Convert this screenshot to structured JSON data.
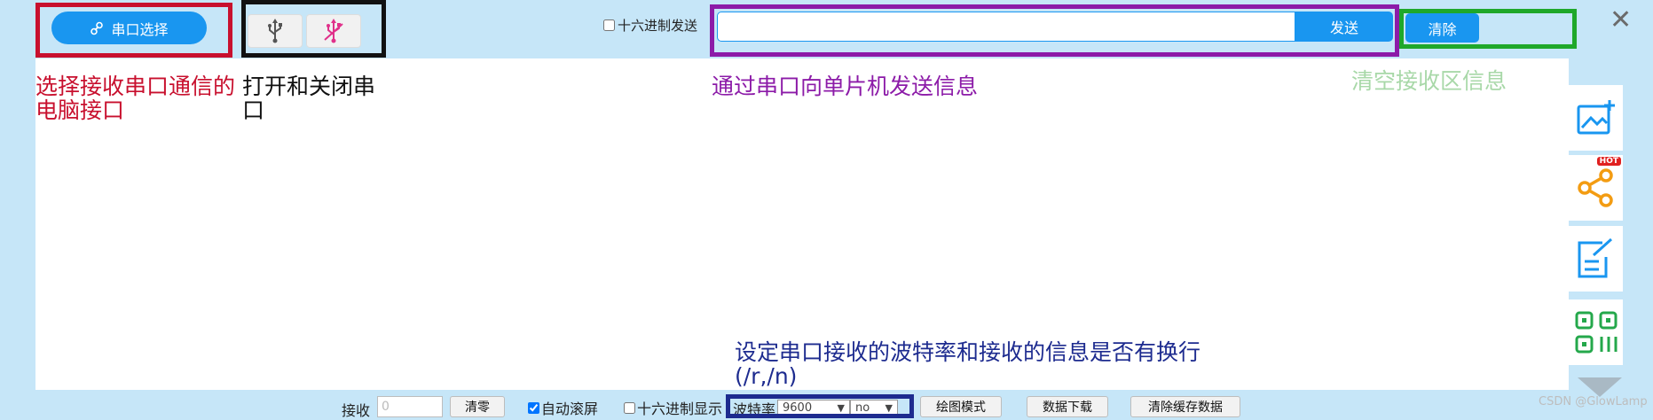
{
  "toolbar": {
    "port_select_label": "串口选择",
    "hex_send_label": "十六进制发送",
    "hex_send_checked": false,
    "send_input_value": "",
    "send_label": "发送",
    "clear_label": "清除",
    "close_symbol": "✕"
  },
  "annotations": {
    "port": "选择接收串口通信的电脑接口",
    "usb": "打开和关闭串口",
    "send": "通过串口向单片机发送信息",
    "clear": "清空接收区信息",
    "baud": "设定串口接收的波特率和接收的信息是否有换行(/r,/n)"
  },
  "sidebar": {
    "items": [
      {
        "icon": "image-add-icon"
      },
      {
        "icon": "share-icon",
        "badge": "HOT"
      },
      {
        "icon": "edit-icon"
      },
      {
        "icon": "qrcode-icon"
      }
    ]
  },
  "bottom": {
    "receive_label": "接收",
    "receive_count_placeholder": "0",
    "zero_label": "清零",
    "auto_scroll_label": "自动滚屏",
    "auto_scroll_checked": true,
    "hex_display_label": "十六进制显示",
    "hex_display_checked": false,
    "baud_label": "波特率",
    "baud_value": "9600",
    "newline_value": "no",
    "plot_mode_label": "绘图模式",
    "data_download_label": "数据下载",
    "clear_cache_label": "清除缓存数据"
  },
  "watermark": "CSDN @GlowLamp",
  "colors": {
    "accent": "#1996f0",
    "background": "#c6e6f8",
    "annotation_red": "#c8102e",
    "annotation_purple": "#8c1ba8",
    "annotation_green": "#1fa82a",
    "annotation_navy": "#1d2b8f",
    "usb_off": "#e0308a",
    "share_icon": "#f39c12"
  }
}
